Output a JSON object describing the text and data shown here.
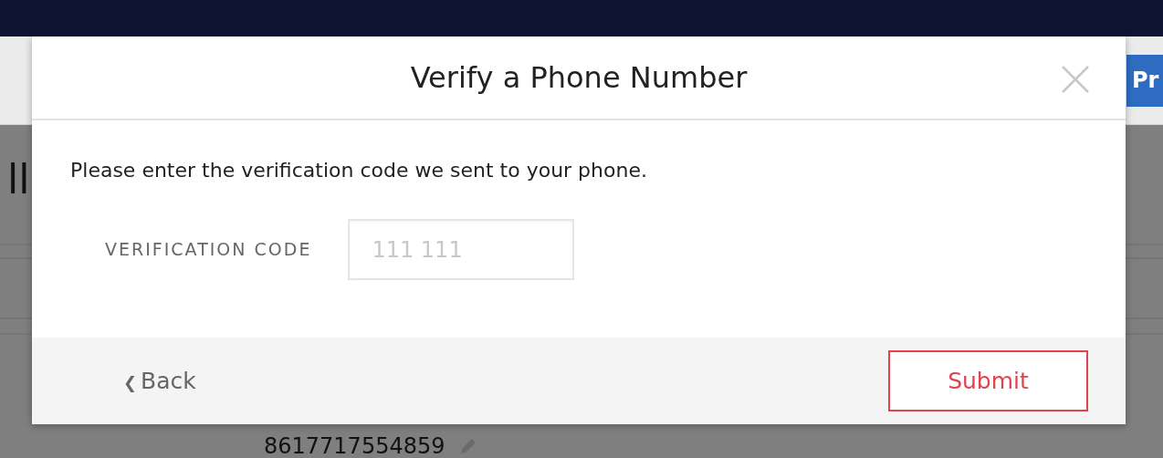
{
  "page": {
    "header_button": "Pr",
    "heading_fragment": "ll",
    "phone_number": "8617717554859"
  },
  "modal": {
    "title": "Verify a Phone Number",
    "message": "Please enter the verification code we sent to your phone.",
    "field": {
      "label": "VERIFICATION CODE",
      "placeholder": "111 111"
    },
    "back": {
      "icon": "❮",
      "label": "Back"
    },
    "submit": "Submit"
  }
}
